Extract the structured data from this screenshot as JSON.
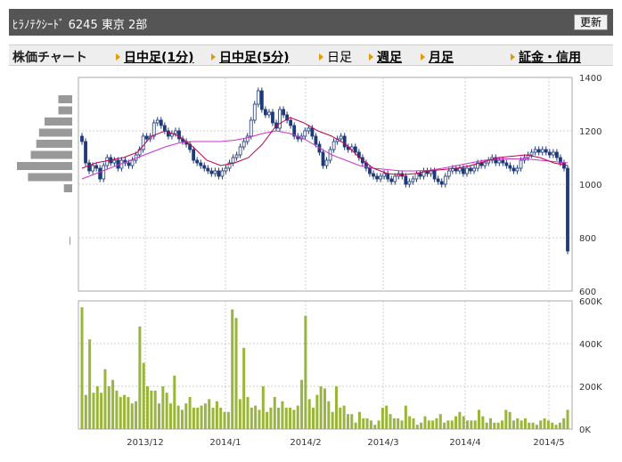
{
  "header": {
    "title": "ﾋﾗﾉﾃｸｼｰﾄﾞ  6245  東京 2部",
    "refresh_label": "更新"
  },
  "tabbar": {
    "title": "株価チャート",
    "tabs": [
      {
        "label": "日中足(1分)",
        "active": false
      },
      {
        "label": "日中足(5分)",
        "active": false
      },
      {
        "label": "日足",
        "active": true
      },
      {
        "label": "週足",
        "active": false
      },
      {
        "label": "月足",
        "active": false
      },
      {
        "label": "証金・信用",
        "active": false
      }
    ]
  },
  "colors": {
    "candle": "#1f3a7a",
    "ma_short": "#c0004a",
    "ma_long": "#cc33cc",
    "volume": "#99b53a",
    "grid": "#cccccc",
    "volume_profile": "#999999"
  },
  "chart_data": [
    {
      "type": "candlestick",
      "title": "",
      "yticks": [
        "1400",
        "1200",
        "1000",
        "800",
        "600"
      ],
      "ylim": [
        600,
        1400
      ],
      "xticks": [
        "2013/12",
        "2014/1",
        "2014/2",
        "2014/3",
        "2014/4",
        "2014/5"
      ],
      "grid": true,
      "candles_close_approx": [
        1160,
        1080,
        1050,
        1070,
        1060,
        1020,
        1070,
        1100,
        1080,
        1090,
        1060,
        1090,
        1080,
        1070,
        1090,
        1110,
        1130,
        1180,
        1170,
        1180,
        1230,
        1240,
        1220,
        1200,
        1180,
        1190,
        1200,
        1170,
        1160,
        1150,
        1130,
        1090,
        1080,
        1070,
        1060,
        1050,
        1040,
        1050,
        1030,
        1050,
        1060,
        1080,
        1100,
        1110,
        1140,
        1160,
        1180,
        1240,
        1300,
        1350,
        1280,
        1260,
        1270,
        1230,
        1210,
        1280,
        1260,
        1240,
        1220,
        1180,
        1170,
        1180,
        1200,
        1210,
        1180,
        1150,
        1120,
        1070,
        1090,
        1130,
        1160,
        1170,
        1180,
        1140,
        1130,
        1140,
        1120,
        1100,
        1080,
        1060,
        1040,
        1030,
        1020,
        1030,
        1040,
        1020,
        1010,
        1030,
        1040,
        1030,
        1000,
        1010,
        1020,
        1040,
        1030,
        1050,
        1040,
        1050,
        1020,
        1010,
        1000,
        1030,
        1050,
        1060,
        1050,
        1060,
        1040,
        1060,
        1050,
        1060,
        1080,
        1070,
        1080,
        1090,
        1100,
        1080,
        1090,
        1080,
        1070,
        1060,
        1050,
        1060,
        1090,
        1100,
        1110,
        1120,
        1130,
        1120,
        1130,
        1120,
        1110,
        1120,
        1100,
        1080,
        1060,
        750
      ],
      "moving_average_short_approx": [
        1060,
        1080,
        1090,
        1100,
        1120,
        1180,
        1200,
        1180,
        1140,
        1090,
        1070,
        1080,
        1100,
        1150,
        1220,
        1250,
        1230,
        1200,
        1180,
        1150,
        1100,
        1060,
        1040,
        1035,
        1040,
        1050,
        1055,
        1060,
        1070,
        1085,
        1100,
        1105,
        1110,
        1100,
        1080,
        1070
      ],
      "moving_average_long_approx": [
        1020,
        1040,
        1060,
        1080,
        1100,
        1120,
        1140,
        1155,
        1160,
        1160,
        1160,
        1165,
        1175,
        1190,
        1200,
        1190,
        1170,
        1140,
        1110,
        1090,
        1070,
        1060,
        1055,
        1050,
        1050,
        1052,
        1060,
        1070,
        1080,
        1090,
        1095,
        1095,
        1095,
        1090,
        1085,
        1080
      ]
    },
    {
      "type": "bar",
      "title": "",
      "series": [
        {
          "values": [
            570000,
            160000,
            420000,
            170000,
            200000,
            170000,
            280000,
            200000,
            230000,
            180000,
            150000,
            160000,
            150000,
            120000,
            130000,
            480000,
            310000,
            200000,
            180000,
            180000,
            120000,
            200000,
            170000,
            120000,
            250000,
            110000,
            90000,
            120000,
            150000,
            100000,
            100000,
            110000,
            120000,
            140000,
            100000,
            130000,
            100000,
            80000,
            80000,
            560000,
            520000,
            140000,
            380000,
            150000,
            100000,
            110000,
            90000,
            200000,
            80000,
            100000,
            150000,
            100000,
            130000,
            100000,
            100000,
            90000,
            110000,
            230000,
            530000,
            140000,
            100000,
            160000,
            200000,
            190000,
            130000,
            80000,
            200000,
            100000,
            110000,
            70000,
            70000,
            30000,
            80000,
            50000,
            50000,
            40000,
            20000,
            40000,
            100000,
            110000,
            70000,
            50000,
            50000,
            40000,
            110000,
            60000,
            50000,
            20000,
            30000,
            60000,
            40000,
            40000,
            50000,
            70000,
            30000,
            40000,
            40000,
            60000,
            80000,
            60000,
            40000,
            40000,
            40000,
            90000,
            60000,
            30000,
            50000,
            30000,
            30000,
            40000,
            90000,
            80000,
            40000,
            50000,
            40000,
            50000,
            30000,
            30000,
            20000,
            40000,
            50000,
            40000,
            30000,
            20000,
            30000,
            50000,
            90000
          ]
        }
      ],
      "yticks": [
        "600K",
        "400K",
        "200K",
        "0K"
      ],
      "ylim": [
        0,
        600000
      ],
      "xticks": [
        "2013/12",
        "2014/1",
        "2014/2",
        "2014/3",
        "2014/4",
        "2014/5"
      ],
      "grid": true
    },
    {
      "type": "bar",
      "title": "",
      "orientation": "horizontal",
      "values_relative": [
        0.25,
        0.25,
        0.5,
        0.6,
        0.65,
        0.75,
        1.0,
        0.8,
        0.15
      ]
    }
  ]
}
